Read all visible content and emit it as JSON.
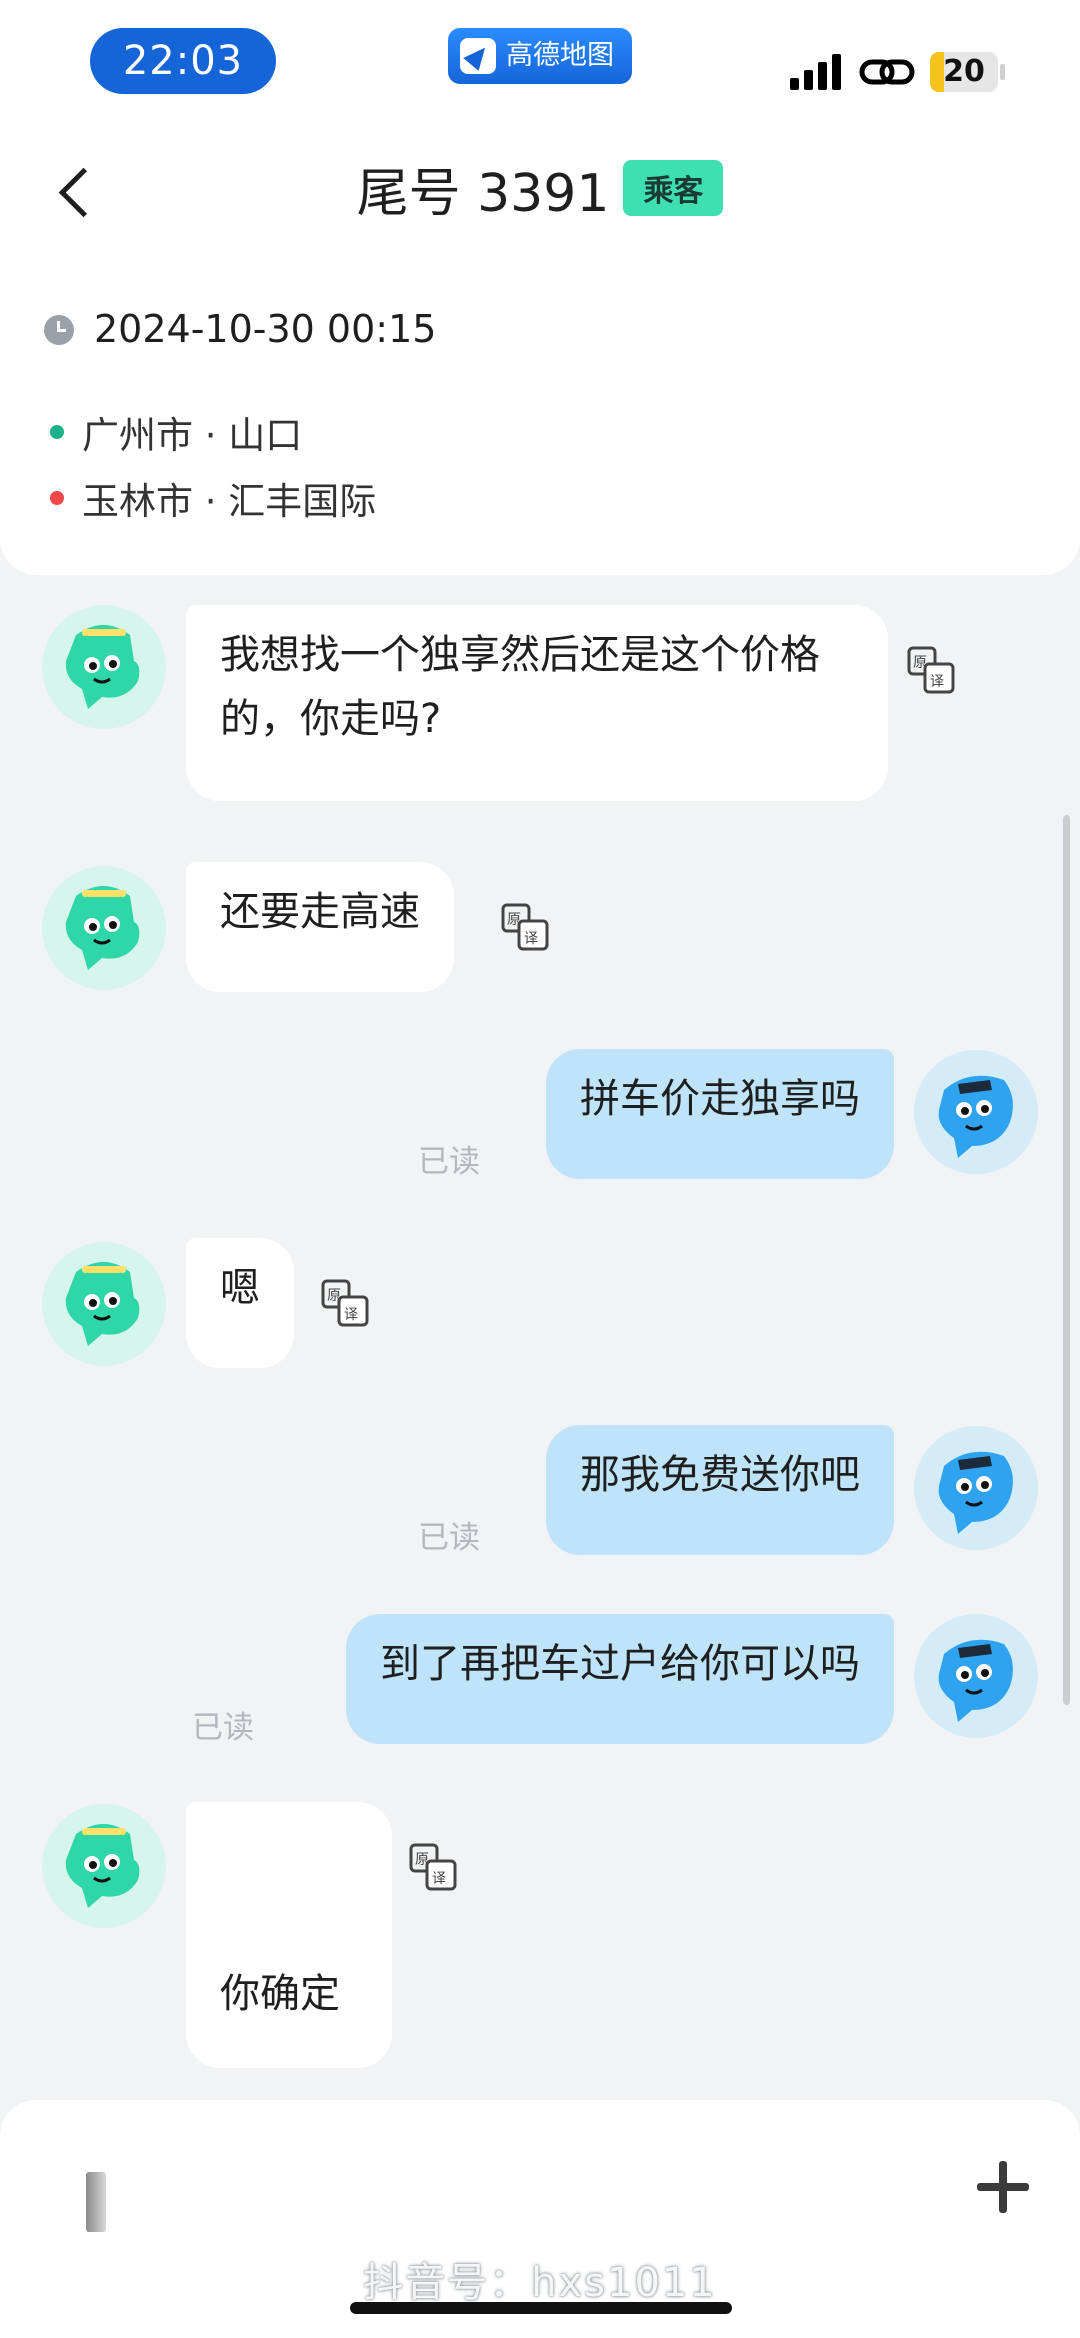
{
  "status_bar": {
    "time": "22:03",
    "app_badge": "高德地图",
    "battery_level": "20",
    "battery_fraction": 0.2,
    "accent_color": "#1565d8"
  },
  "header": {
    "title": "尾号 3391",
    "role_tag": "乘客",
    "tag_color": "#3fe0b0"
  },
  "trip": {
    "datetime": "2024-10-30 00:15",
    "origin": "广州市 · 山口",
    "destination": "玉林市 · 汇丰国际",
    "origin_color": "#19b38a",
    "destination_color": "#f04848"
  },
  "chat": {
    "read_label": "已读",
    "translate_icon": "translate-icon",
    "messages": [
      {
        "from": "passenger",
        "text": "我想找一个独享然后还是这个价格的，你走吗?"
      },
      {
        "from": "passenger",
        "text": "还要走高速"
      },
      {
        "from": "driver",
        "text": "拼车价走独享吗",
        "status": "已读"
      },
      {
        "from": "passenger",
        "text": "嗯"
      },
      {
        "from": "driver",
        "text": "那我免费送你吧",
        "status": "已读"
      },
      {
        "from": "driver",
        "text": "到了再把车过户给你可以吗",
        "status": "已读"
      },
      {
        "from": "passenger",
        "text": "你确定"
      }
    ]
  },
  "input": {
    "plus_icon": "plus-icon"
  },
  "watermark": "抖音号：hxs1011"
}
